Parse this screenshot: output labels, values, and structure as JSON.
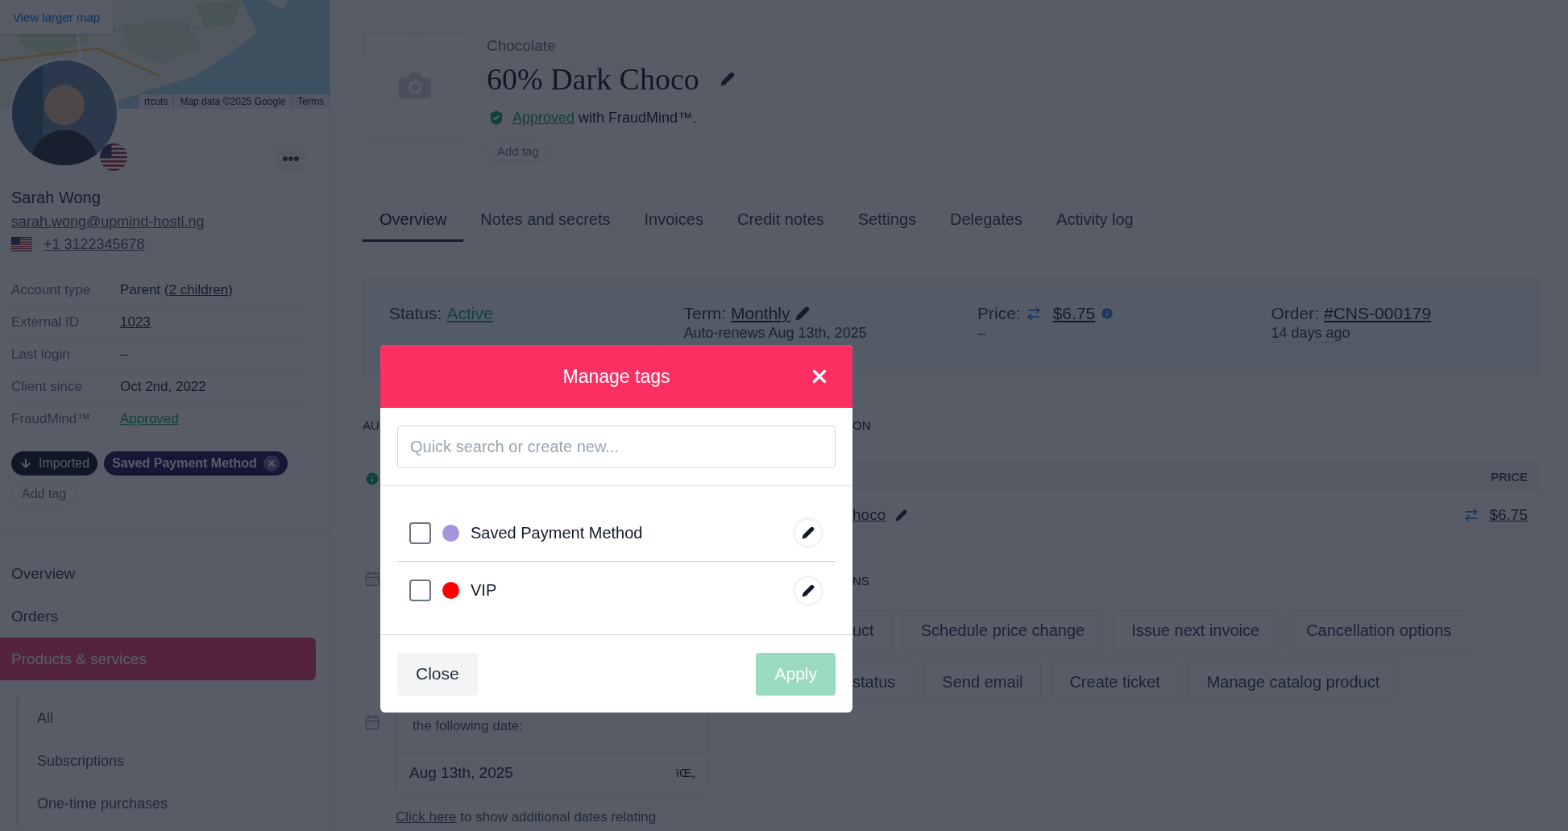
{
  "map": {
    "button": "View larger map",
    "attribution": [
      "rtcuts",
      "Map data ©2025 Google",
      "Terms"
    ]
  },
  "profile": {
    "name": "Sarah Wong",
    "email": "sarah.wong@upmind-hosti.ng",
    "phone": "+1 3122345678"
  },
  "details": [
    {
      "label": "Account type",
      "kind": "mixed",
      "prefix": "Parent (",
      "link": "2 children",
      "suffix": ")"
    },
    {
      "label": "External ID",
      "kind": "link",
      "value": "1023"
    },
    {
      "label": "Last login",
      "kind": "plain",
      "value": "–"
    },
    {
      "label": "Client since",
      "kind": "plain",
      "value": "Oct 2nd, 2022"
    },
    {
      "label": "FraudMind™",
      "kind": "status",
      "value": "Approved"
    }
  ],
  "client_tags": [
    {
      "label": "Imported",
      "kind": "imported"
    },
    {
      "label": "Saved Payment Method",
      "kind": "removable"
    }
  ],
  "add_tag": "Add tag",
  "nav": [
    {
      "label": "Overview",
      "selected": false
    },
    {
      "label": "Orders",
      "selected": false
    },
    {
      "label": "Products & services",
      "selected": true,
      "children": [
        {
          "label": "All",
          "selected": false
        },
        {
          "label": "Subscriptions",
          "selected": false
        },
        {
          "label": "One-time purchases",
          "selected": false
        }
      ]
    }
  ],
  "product": {
    "category": "Chocolate",
    "title": "60% Dark Choco",
    "fraud_link": "Approved",
    "fraud_text": "with FraudMind™.",
    "add_tag": "Add tag"
  },
  "tabs": [
    {
      "label": "Overview",
      "selected": true
    },
    {
      "label": "Notes and secrets",
      "selected": false
    },
    {
      "label": "Invoices",
      "selected": false
    },
    {
      "label": "Credit notes",
      "selected": false
    },
    {
      "label": "Settings",
      "selected": false
    },
    {
      "label": "Delegates",
      "selected": false
    },
    {
      "label": "Activity log",
      "selected": false
    }
  ],
  "summary": [
    {
      "label": "Status:",
      "value": "Active",
      "kind": "status"
    },
    {
      "label": "Term:",
      "value": "Monthly",
      "kind": "editable",
      "note": "Auto-renews Aug 13th, 2025"
    },
    {
      "label": "Price:",
      "value": "$6.75",
      "kind": "price",
      "note": "–"
    },
    {
      "label": "Order:",
      "value": "#CNS-000179",
      "kind": "order",
      "note": "14 days ago"
    }
  ],
  "left_section": {
    "heading": "AU",
    "date_label": "the following date:",
    "date": "Aug 13th, 2025",
    "date_glyph": "ïŒ„",
    "link": "Click here",
    "link_rest": "to show additional dates relating"
  },
  "right_section": {
    "heading": "ON",
    "column": "PRICE",
    "row": {
      "name": "hoco",
      "price": "$6.75"
    },
    "actions_heading": "NS",
    "actions": [
      [
        "uct",
        "Schedule price change",
        "Issue next invoice",
        "Cancellation options"
      ],
      [
        "status",
        "Send email",
        "Create ticket",
        "Manage catalog product"
      ]
    ]
  },
  "modal": {
    "title": "Manage tags",
    "search_placeholder": "Quick search or create new...",
    "tags": [
      {
        "label": "Saved Payment Method",
        "color": "#a594db",
        "checked": false
      },
      {
        "label": "VIP",
        "color": "#ff0000",
        "checked": false
      }
    ],
    "close": "Close",
    "apply": "Apply",
    "apply_disabled": true
  }
}
